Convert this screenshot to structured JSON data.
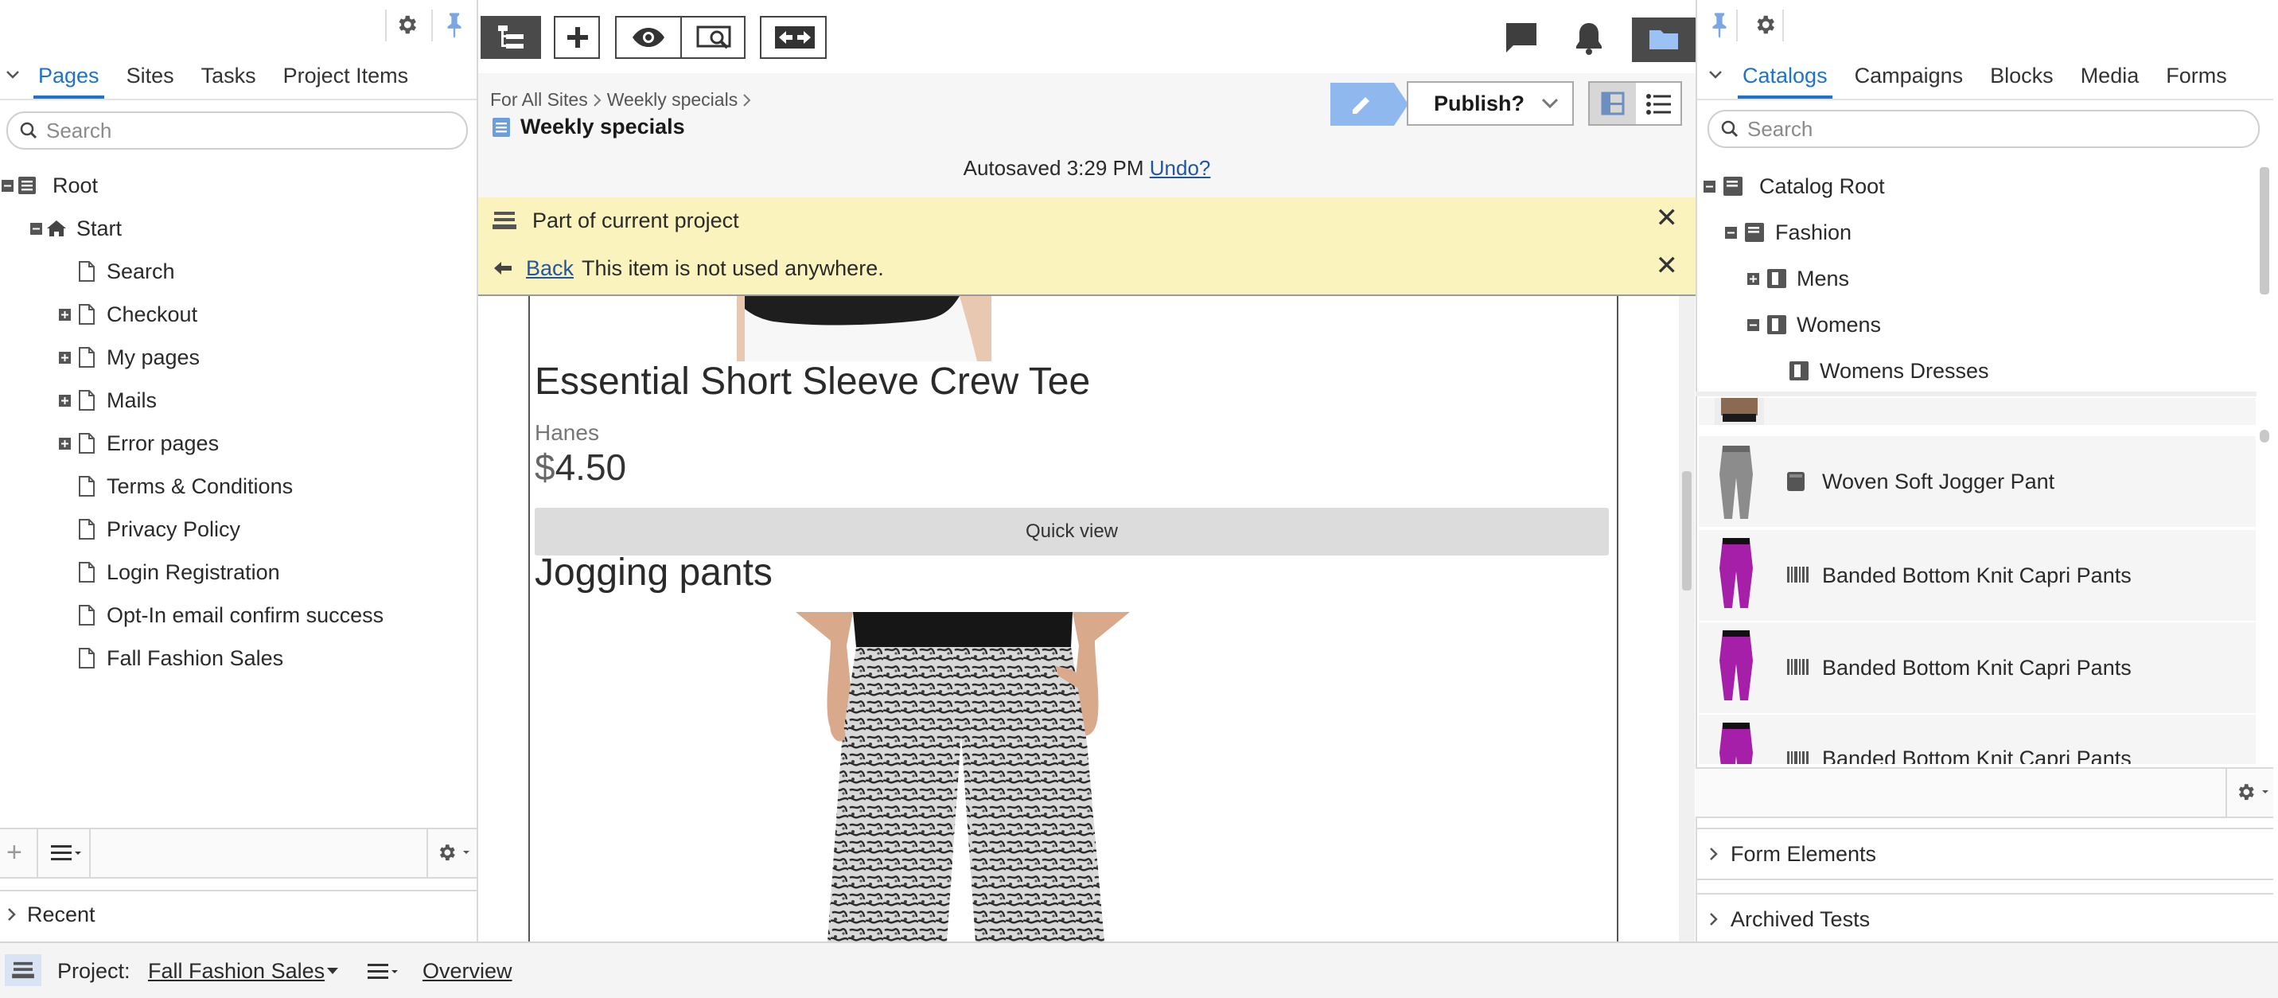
{
  "left_pane": {
    "tabs": [
      "Pages",
      "Sites",
      "Tasks",
      "Project Items"
    ],
    "active_tab": "Pages",
    "search_placeholder": "Search",
    "tree": [
      {
        "label": "Root",
        "expander": "minus",
        "icon": "list-icon"
      },
      {
        "label": "Start",
        "expander": "minus",
        "icon": "home-icon"
      },
      {
        "label": "Search",
        "expander": "",
        "icon": "page-icon"
      },
      {
        "label": "Checkout",
        "expander": "plus",
        "icon": "page-icon"
      },
      {
        "label": "My pages",
        "expander": "plus",
        "icon": "page-icon"
      },
      {
        "label": "Mails",
        "expander": "plus",
        "icon": "page-icon"
      },
      {
        "label": "Error pages",
        "expander": "plus",
        "icon": "page-icon"
      },
      {
        "label": "Terms & Conditions",
        "expander": "",
        "icon": "page-icon"
      },
      {
        "label": "Privacy Policy",
        "expander": "",
        "icon": "page-icon"
      },
      {
        "label": "Login Registration",
        "expander": "",
        "icon": "page-icon"
      },
      {
        "label": "Opt-In email confirm success",
        "expander": "",
        "icon": "page-icon"
      },
      {
        "label": "Fall Fashion Sales",
        "expander": "",
        "icon": "page-icon"
      }
    ],
    "recent_label": "Recent"
  },
  "center": {
    "breadcrumb": [
      "For All Sites",
      "Weekly specials"
    ],
    "page_title": "Weekly specials",
    "publish_label": "Publish?",
    "autosave_text": "Autosaved 3:29 PM",
    "undo_label": "Undo?",
    "banner_project": "Part of current project",
    "banner_back": "Back",
    "banner_unused": "This item is not used anywhere.",
    "product": {
      "name": "Essential Short Sleeve Crew Tee",
      "brand": "Hanes",
      "currency": "$",
      "price": "4.50",
      "quick_view": "Quick view"
    },
    "next_product_name": "Jogging pants"
  },
  "right_pane": {
    "tabs": [
      "Catalogs",
      "Campaigns",
      "Blocks",
      "Media",
      "Forms"
    ],
    "active_tab": "Catalogs",
    "search_placeholder": "Search",
    "tree": [
      {
        "label": "Catalog Root",
        "expander": "minus"
      },
      {
        "label": "Fashion",
        "expander": "minus"
      },
      {
        "label": "Mens",
        "expander": "plus"
      },
      {
        "label": "Womens",
        "expander": "minus"
      },
      {
        "label": "Womens Dresses",
        "expander": ""
      }
    ],
    "items": [
      {
        "label": "Woven Soft Jogger Pant",
        "type_icon": "product-icon",
        "color": "#8c8c8c"
      },
      {
        "label": "Banded Bottom Knit Capri Pants",
        "type_icon": "barcode-icon",
        "color": "#a61fa8"
      },
      {
        "label": "Banded Bottom Knit Capri Pants",
        "type_icon": "barcode-icon",
        "color": "#a61fa8"
      },
      {
        "label": "Banded Bottom Knit Capri Pants",
        "type_icon": "barcode-icon",
        "color": "#a61fa8"
      }
    ],
    "accordions": [
      "Form Elements",
      "Archived Tests"
    ]
  },
  "bottom_bar": {
    "project_label": "Project:",
    "project_name": "Fall Fashion Sales",
    "overview_label": "Overview"
  },
  "colors": {
    "accent": "#1f73c8",
    "banner": "#fbf3bd",
    "edit_button": "#8fb8ee",
    "toolbar_dark": "#4a4a4a"
  }
}
